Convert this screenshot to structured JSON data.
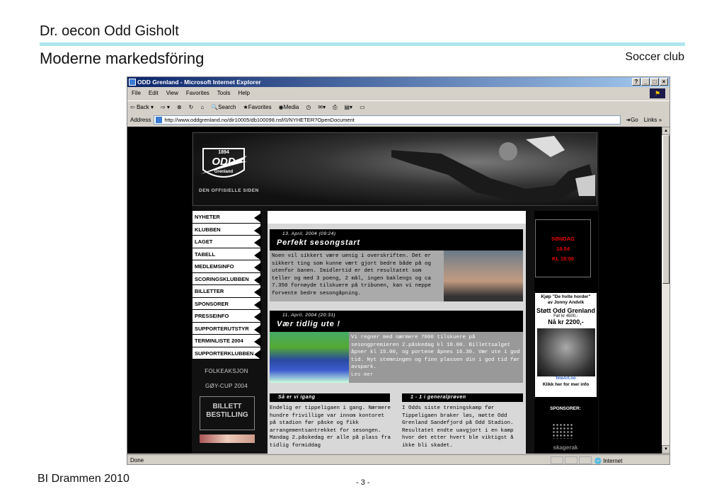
{
  "slide": {
    "title": "Dr. oecon Odd Gisholt",
    "subtitle": "Moderne markedsföring",
    "tag": "Soccer club",
    "footer": "BI Drammen 2010",
    "page": "- 3 -",
    "accent": "#aee6ee"
  },
  "window": {
    "title": "ODD Grenland - Microsoft Internet Explorer",
    "menu": [
      "File",
      "Edit",
      "View",
      "Favorites",
      "Tools",
      "Help"
    ],
    "toolbar": {
      "back": "Back",
      "search": "Search",
      "favorites": "Favorites",
      "media": "Media"
    },
    "address_label": "Address",
    "url": "http://www.oddgrenland.no/dir10005/db100098.nsf/0/NYHETER?OpenDocument",
    "go": "Go",
    "links": "Links",
    "status": "Done",
    "zone": "Internet"
  },
  "site": {
    "crest_year": "1894",
    "crest_name": "ODD",
    "crest_sub": "Grenland",
    "official": "DEN OFFISIELLE SIDEN",
    "nav": [
      "NYHETER",
      "KLUBBEN",
      "LAGET",
      "TABELL",
      "MEDLEMSINFO",
      "SCORINGSKLUBBEN",
      "BILLETTER",
      "SPONSORER",
      "PRESSEINFO",
      "SUPPORTERUTSTYR",
      "TERMINLISTE 2004",
      "SUPPORTERKLUBBEN"
    ],
    "nav_extra": [
      "FOLKEAKSJON",
      "GØY-CUP 2004"
    ],
    "billett": [
      "BILLETT",
      "BESTILLING"
    ],
    "articles": [
      {
        "date": "13. April, 2004 (09:24)",
        "title": "Perfekt sesongstart",
        "body": "Noen vil sikkert være uenig i overskriften. Det er sikkert ting som kunne vært gjort bedre både på og utenfor banen. Imidlertid er det resultatet som teller og med 3 poeng, 2 mål, ingen baklengs og ca 7.350 fornøyde tilskuere på tribunen, kan vi neppe forvente bedre sesongåpning."
      },
      {
        "date": "11. April, 2004 (20:31)",
        "title": "Vær tidlig ute !",
        "body": "Vi regner med nærmere 7000 tilskuere på sesongpremieren 2.påskedag kl 18.00. Billettsalget åpner kl 15.00, og portene åpnes 16.30. Vær ute i god tid. Nyt stemningen og finn plassen din i god tid før avspark.",
        "more": "Les mer"
      }
    ],
    "sub": [
      {
        "title": "Så er vi igang",
        "body": "Endelig er tippeligaen i gang. Nærmere hundre frivillige var innom kontoret på stadion før påske og fikk arrangementsantrekket for sesongen. Mandag 2.påskedag er alle på plass fra tidlig formiddag"
      },
      {
        "title": "1 - 1 i generalprøven",
        "body": "I Odds siste treningskamp før Tippeligaen braker løs, møtte Odd Grenland Sandefjord på Odd Stadion. Resultatet endte uavgjort i en kamp hvor det etter hvert ble viktigst å ikke bli skadet."
      }
    ],
    "sunday": [
      "SØNDAG",
      "18.04",
      "KL 18:00"
    ],
    "ad": {
      "l1": "Kjøp \"De hvite horder\"",
      "l2": "av Jonny Andvik",
      "l3": "Støtt Odd Grenland",
      "l4": "Før kr 4500,-",
      "l5": "Nå kr 2200,-",
      "l6": "Klikk her for mer info",
      "brand": "fineArt.no"
    },
    "sponsors": "SPONSORER:",
    "sponsor_name": "skagerak"
  }
}
